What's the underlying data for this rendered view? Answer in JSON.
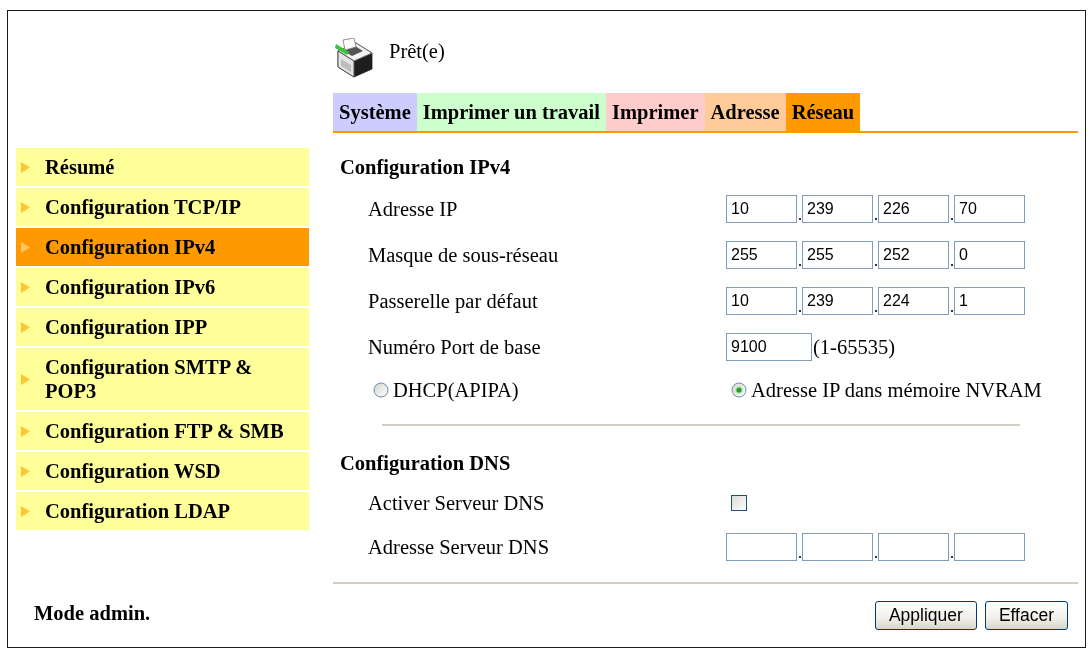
{
  "status": {
    "text": "Prêt(e)"
  },
  "tabs": [
    {
      "label": "Système",
      "color": "#ccccff",
      "selected": false
    },
    {
      "label": "Imprimer un travail",
      "color": "#ccffcc",
      "selected": false
    },
    {
      "label": "Imprimer",
      "color": "#ffcccc",
      "selected": false
    },
    {
      "label": "Adresse",
      "color": "#ffcc99",
      "selected": false
    },
    {
      "label": "Réseau",
      "color": "#ff9900",
      "selected": true
    }
  ],
  "sidebar": {
    "items": [
      {
        "label": "Résumé",
        "selected": false
      },
      {
        "label": "Configuration TCP/IP",
        "selected": false
      },
      {
        "label": "Configuration IPv4",
        "selected": true
      },
      {
        "label": "Configuration IPv6",
        "selected": false
      },
      {
        "label": "Configuration IPP",
        "selected": false
      },
      {
        "label": "Configuration SMTP & POP3",
        "selected": false
      },
      {
        "label": "Configuration FTP & SMB",
        "selected": false
      },
      {
        "label": "Configuration WSD",
        "selected": false
      },
      {
        "label": "Configuration LDAP",
        "selected": false
      }
    ]
  },
  "sections": [
    {
      "title": "Configuration IPv4",
      "rows": [
        {
          "kind": "ip",
          "label": "Adresse IP",
          "octets": [
            "10",
            "239",
            "226",
            "70"
          ]
        },
        {
          "kind": "ip",
          "label": "Masque de sous-réseau",
          "octets": [
            "255",
            "255",
            "252",
            "0"
          ]
        },
        {
          "kind": "ip",
          "label": "Passerelle par défaut",
          "octets": [
            "10",
            "239",
            "224",
            "1"
          ]
        },
        {
          "kind": "port",
          "label": "Numéro Port de base",
          "value": "9100",
          "range": "(1-65535)"
        },
        {
          "kind": "radio",
          "options": [
            {
              "label": "DHCP(APIPA)",
              "selected": false
            },
            {
              "label": "Adresse IP dans mémoire NVRAM",
              "selected": true
            }
          ]
        }
      ]
    },
    {
      "title": "Configuration DNS",
      "rows": [
        {
          "kind": "checkbox",
          "label": "Activer Serveur DNS",
          "checked": false
        },
        {
          "kind": "ip",
          "label": "Adresse Serveur DNS"
        }
      ]
    }
  ],
  "footer": {
    "mode": "Mode admin.",
    "buttons": [
      "Appliquer",
      "Effacer"
    ]
  }
}
